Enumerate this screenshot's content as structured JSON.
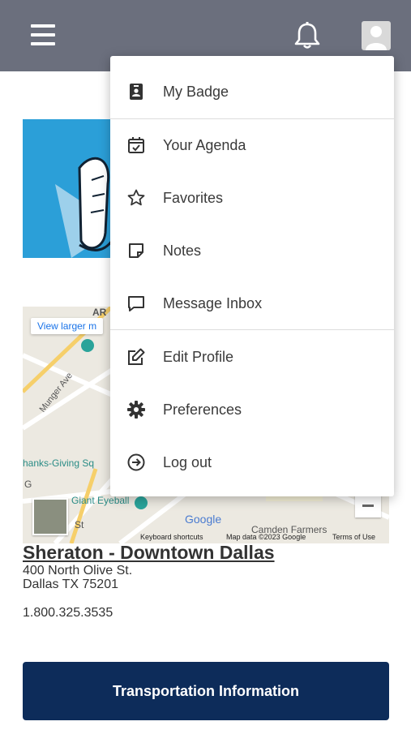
{
  "header": {
    "menu_icon": "hamburger-icon",
    "notifications_icon": "bell-icon",
    "profile_icon": "user-avatar-icon",
    "background": "#6b6f7d"
  },
  "user_menu": {
    "items": [
      {
        "label": "My Badge",
        "icon": "badge-icon"
      },
      {
        "label": "Your Agenda",
        "icon": "calendar-check-icon"
      },
      {
        "label": "Favorites",
        "icon": "star-icon"
      },
      {
        "label": "Notes",
        "icon": "note-icon"
      },
      {
        "label": "Message Inbox",
        "icon": "message-icon"
      },
      {
        "label": "Edit Profile",
        "icon": "edit-icon"
      },
      {
        "label": "Preferences",
        "icon": "gear-icon"
      },
      {
        "label": "Log out",
        "icon": "logout-icon"
      }
    ]
  },
  "map": {
    "view_larger_link": "View larger m",
    "labels": {
      "street_1": "Munger Ave",
      "place_1": "hanks-Giving Sq",
      "place_2": "Giant Eyeball",
      "street_2": "St",
      "place_3": "Camden Farmers",
      "partial_top": "AR",
      "partial_g": "G"
    },
    "logo": "Google",
    "footer": {
      "shortcuts": "Keyboard shortcuts",
      "data": "Map data ©2023 Google",
      "terms": "Terms of Use"
    }
  },
  "hotel": {
    "name": "Sheraton - Downtown Dallas",
    "address_line1": "400 North Olive St.",
    "address_line2": "Dallas TX 75201",
    "phone": "1.800.325.3535"
  },
  "buttons": {
    "transportation": "Transportation Information"
  },
  "colors": {
    "primary_button": "#0d2c5a",
    "hero_background": "#2b9fd8"
  }
}
